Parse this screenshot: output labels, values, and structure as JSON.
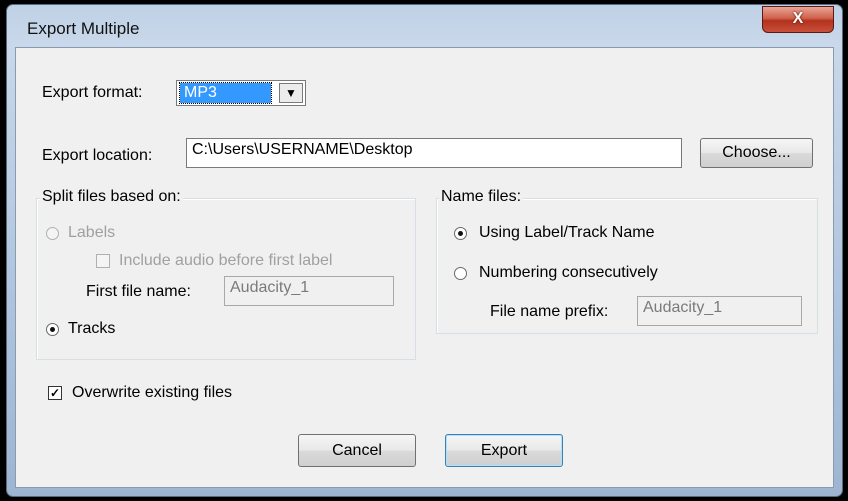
{
  "window": {
    "title": "Export Multiple",
    "close_glyph": "X"
  },
  "export_format": {
    "label": "Export format:",
    "value": "MP3"
  },
  "export_location": {
    "label": "Export location:",
    "value": "C:\\Users\\USERNAME\\Desktop",
    "choose_button": "Choose..."
  },
  "split_group": {
    "title": "Split files based on:",
    "labels_option": "Labels",
    "include_audio": "Include audio before first label",
    "first_file_name_label": "First file name:",
    "first_file_name_value": "Audacity_1",
    "tracks_option": "Tracks",
    "selected": "tracks"
  },
  "name_group": {
    "title": "Name files:",
    "label_track_option": "Using Label/Track Name",
    "numbering_option": "Numbering consecutively",
    "prefix_label": "File name prefix:",
    "prefix_value": "Audacity_1",
    "selected": "label_track"
  },
  "overwrite": {
    "label": "Overwrite existing files",
    "checked": true
  },
  "buttons": {
    "cancel": "Cancel",
    "export": "Export"
  },
  "colors": {
    "selection": "#3399ff",
    "close_button": "#c9503a",
    "disabled_text": "#a0a0a0"
  },
  "icons": {
    "dropdown": "chevron-down-icon",
    "close": "close-icon"
  }
}
